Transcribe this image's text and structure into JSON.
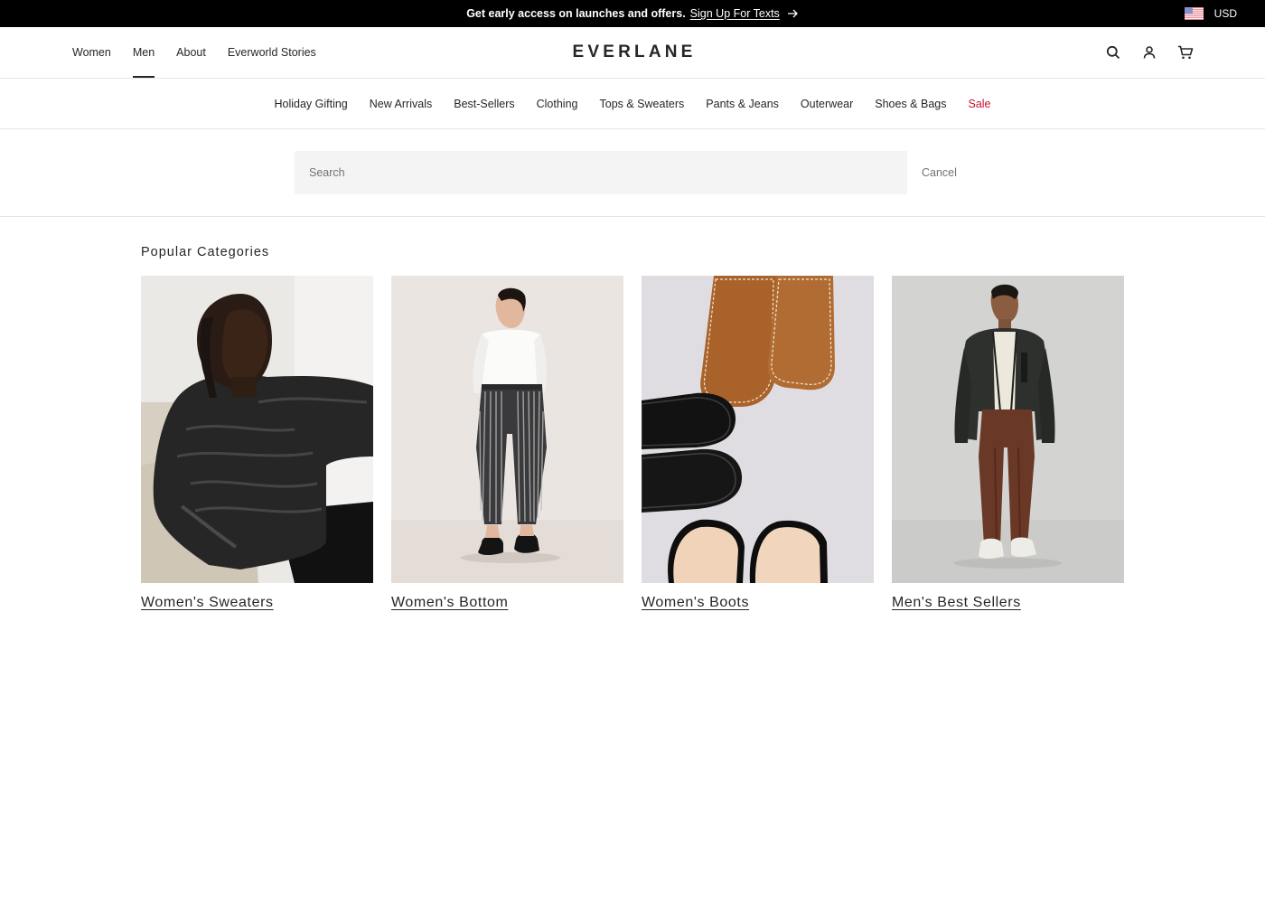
{
  "promo": {
    "text": "Get early access on launches and offers.",
    "link": "Sign Up For Texts",
    "arrow_icon": "arrow-right-icon"
  },
  "currency": {
    "flag_icon": "us-flag-icon",
    "code": "USD"
  },
  "header": {
    "nav": [
      {
        "label": "Women",
        "active": false
      },
      {
        "label": "Men",
        "active": true
      },
      {
        "label": "About",
        "active": false
      },
      {
        "label": "Everworld Stories",
        "active": false
      }
    ],
    "logo": "EVERLANE",
    "icons": [
      "search-icon",
      "account-icon",
      "cart-icon"
    ]
  },
  "categories": [
    {
      "label": "Holiday Gifting"
    },
    {
      "label": "New Arrivals"
    },
    {
      "label": "Best-Sellers"
    },
    {
      "label": "Clothing"
    },
    {
      "label": "Tops & Sweaters"
    },
    {
      "label": "Pants & Jeans"
    },
    {
      "label": "Outerwear"
    },
    {
      "label": "Shoes & Bags"
    },
    {
      "label": "Sale",
      "color": "#c8102e"
    }
  ],
  "search": {
    "placeholder": "Search",
    "value": "",
    "cancel_label": "Cancel"
  },
  "popular": {
    "title": "Popular Categories",
    "cards": [
      {
        "label": "Women's Sweaters"
      },
      {
        "label": "Women's Bottom"
      },
      {
        "label": "Women's Boots"
      },
      {
        "label": "Men's Best Sellers"
      }
    ]
  },
  "colors": {
    "promo_bg": "#000000",
    "text": "#262626",
    "muted": "#737373",
    "sale": "#c8102e",
    "search_bg": "#f5f4f4",
    "divider": "#e6e6e6"
  }
}
